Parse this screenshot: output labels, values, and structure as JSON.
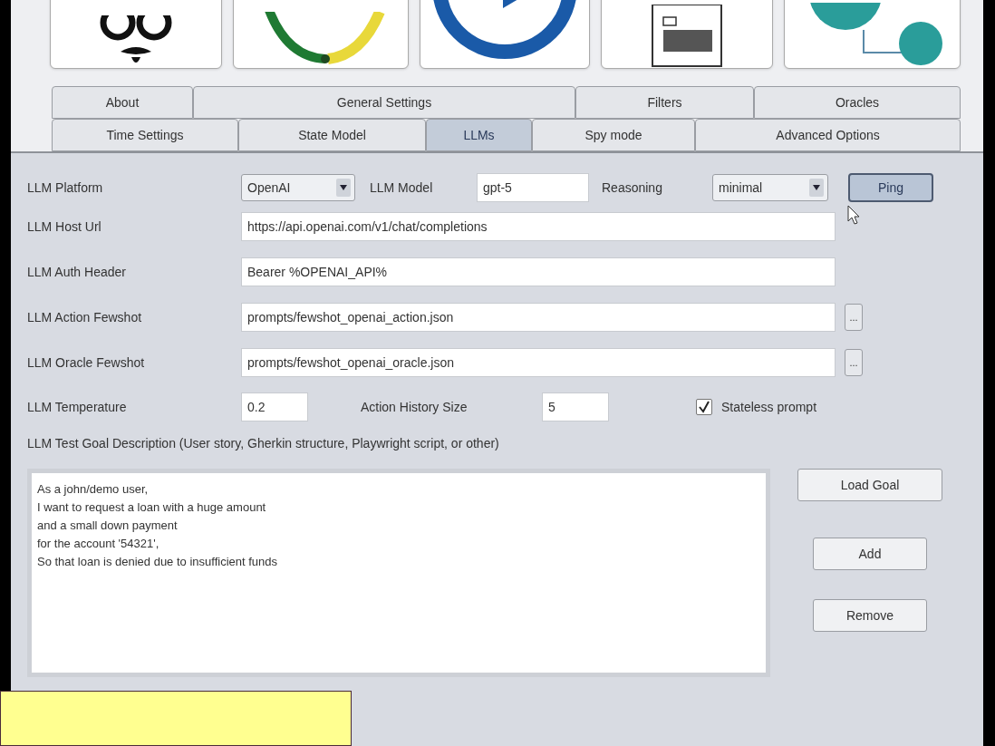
{
  "toolbar_icons": [
    {
      "kind": "glasses"
    },
    {
      "kind": "cycle"
    },
    {
      "kind": "ring"
    },
    {
      "kind": "document"
    },
    {
      "kind": "bubbles"
    }
  ],
  "tab_rows": [
    [
      {
        "label": "About",
        "selected": false
      },
      {
        "label": "General Settings",
        "selected": false
      },
      {
        "label": "Filters",
        "selected": false
      },
      {
        "label": "Oracles",
        "selected": false
      }
    ],
    [
      {
        "label": "Time Settings",
        "selected": false
      },
      {
        "label": "State Model",
        "selected": false
      },
      {
        "label": "LLMs",
        "selected": true
      },
      {
        "label": "Spy mode",
        "selected": false
      },
      {
        "label": "Advanced Options",
        "selected": false
      }
    ]
  ],
  "platform": {
    "label": "LLM Platform",
    "value": "OpenAI"
  },
  "model": {
    "label": "LLM Model",
    "value": "gpt-5"
  },
  "reasoning": {
    "label": "Reasoning",
    "value": "minimal"
  },
  "ping_button": "Ping",
  "fields": [
    {
      "label": "LLM Host Url",
      "value": "https://api.openai.com/v1/chat/completions"
    },
    {
      "label": "LLM Auth Header",
      "value": "Bearer %OPENAI_API%"
    },
    {
      "label": "LLM Action Fewshot",
      "value": "prompts/fewshot_openai_action.json",
      "browse": "..."
    },
    {
      "label": "LLM Oracle Fewshot",
      "value": "prompts/fewshot_openai_oracle.json",
      "browse": "..."
    }
  ],
  "temperature": {
    "label": "LLM Temperature",
    "value": "0.2"
  },
  "history_size": {
    "label": "Action History Size",
    "value": "5"
  },
  "stateless_prompt": {
    "label": "Stateless prompt",
    "checked": true
  },
  "goal": {
    "label": "LLM Test Goal Description (User story, Gherkin structure, Playwright script, or other)",
    "text": "As a john/demo user,\nI want to request a loan with a huge amount\nand a small down payment\nfor the account '54321',\nSo that loan is denied due to insufficient funds",
    "buttons": [
      "Load Goal",
      "Add",
      "Remove"
    ]
  }
}
